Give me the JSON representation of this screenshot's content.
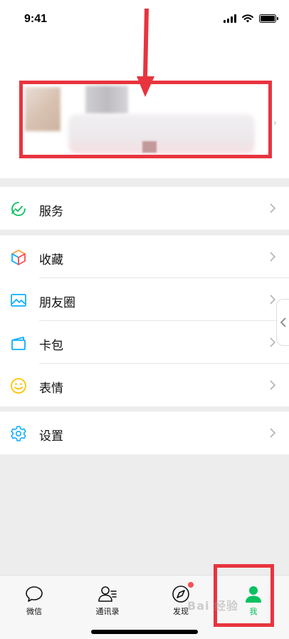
{
  "status_bar": {
    "time": "9:41"
  },
  "services": {
    "label": "服务"
  },
  "menu": [
    {
      "label": "收藏",
      "icon": "favorites-cube-icon"
    },
    {
      "label": "朋友圈",
      "icon": "moments-image-icon"
    },
    {
      "label": "卡包",
      "icon": "card-wallet-icon"
    },
    {
      "label": "表情",
      "icon": "sticker-smiley-icon"
    }
  ],
  "settings": {
    "label": "设置"
  },
  "tabs": [
    {
      "label": "微信",
      "icon": "chat-bubble-icon",
      "active": false
    },
    {
      "label": "通讯录",
      "icon": "contacts-icon",
      "active": false
    },
    {
      "label": "发现",
      "icon": "compass-icon",
      "active": false,
      "badge": "red-dot"
    },
    {
      "label": "我",
      "icon": "person-icon",
      "active": true
    }
  ],
  "watermark": "Bai 经验",
  "colors": {
    "accent_green": "#07c160",
    "annotation_red": "#e8343e",
    "badge_red": "#fa5151"
  }
}
